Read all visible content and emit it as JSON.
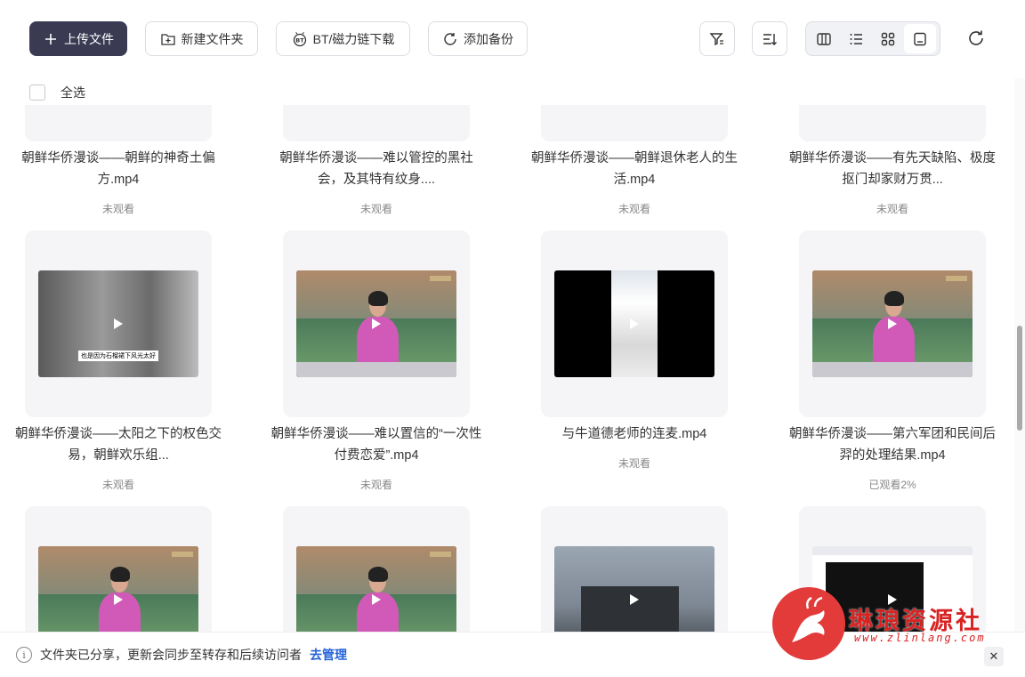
{
  "toolbar": {
    "upload": "上传文件",
    "new_folder": "新建文件夹",
    "bt_download": "BT/磁力链下载",
    "add_backup": "添加备份"
  },
  "select_all": "全选",
  "files": [
    {
      "title": "朝鲜华侨漫谈——朝鲜的神奇土偏方.mp4",
      "status": "未观看",
      "thumb": "blank"
    },
    {
      "title": "朝鲜华侨漫谈——难以管控的黑社会，及其特有纹身....",
      "status": "未观看",
      "thumb": "blank"
    },
    {
      "title": "朝鲜华侨漫谈——朝鲜退休老人的生活.mp4",
      "status": "未观看",
      "thumb": "blank"
    },
    {
      "title": "朝鲜华侨漫谈——有先天缺陷、极度抠门却家财万贯...",
      "status": "未观看",
      "thumb": "blank"
    },
    {
      "title": "朝鲜华侨漫谈——太阳之下的权色交易，朝鲜欢乐组...",
      "status": "未观看",
      "thumb": "street",
      "caption": "也是因为石榴裙下风光太好"
    },
    {
      "title": "朝鲜华侨漫谈——难以置信的“一次性付费恋爱”.mp4",
      "status": "未观看",
      "thumb": "news"
    },
    {
      "title": "与牛道德老师的连麦.mp4",
      "status": "未观看",
      "thumb": "phone"
    },
    {
      "title": "朝鲜华侨漫谈——第六军团和民间后羿的处理结果.mp4",
      "status": "已观看2%",
      "thumb": "news"
    },
    {
      "title": "",
      "status": "",
      "thumb": "news"
    },
    {
      "title": "",
      "status": "",
      "thumb": "news"
    },
    {
      "title": "",
      "status": "",
      "thumb": "building"
    },
    {
      "title": "",
      "status": "",
      "thumb": "browser"
    }
  ],
  "banner": {
    "text": "文件夹已分享，更新会同步至转存和后续访问者",
    "manage": "去管理"
  },
  "watermark": {
    "text": "琳琅资源社",
    "url": "www.zlinlang.com"
  },
  "icons": [
    "plus-icon",
    "folder-add-icon",
    "bt-icon",
    "backup-icon",
    "filter-icon",
    "sort-icon",
    "column-view-icon",
    "list-view-icon",
    "grid-view-icon",
    "preview-view-icon",
    "refresh-icon",
    "info-icon",
    "close-icon",
    "play-icon"
  ]
}
